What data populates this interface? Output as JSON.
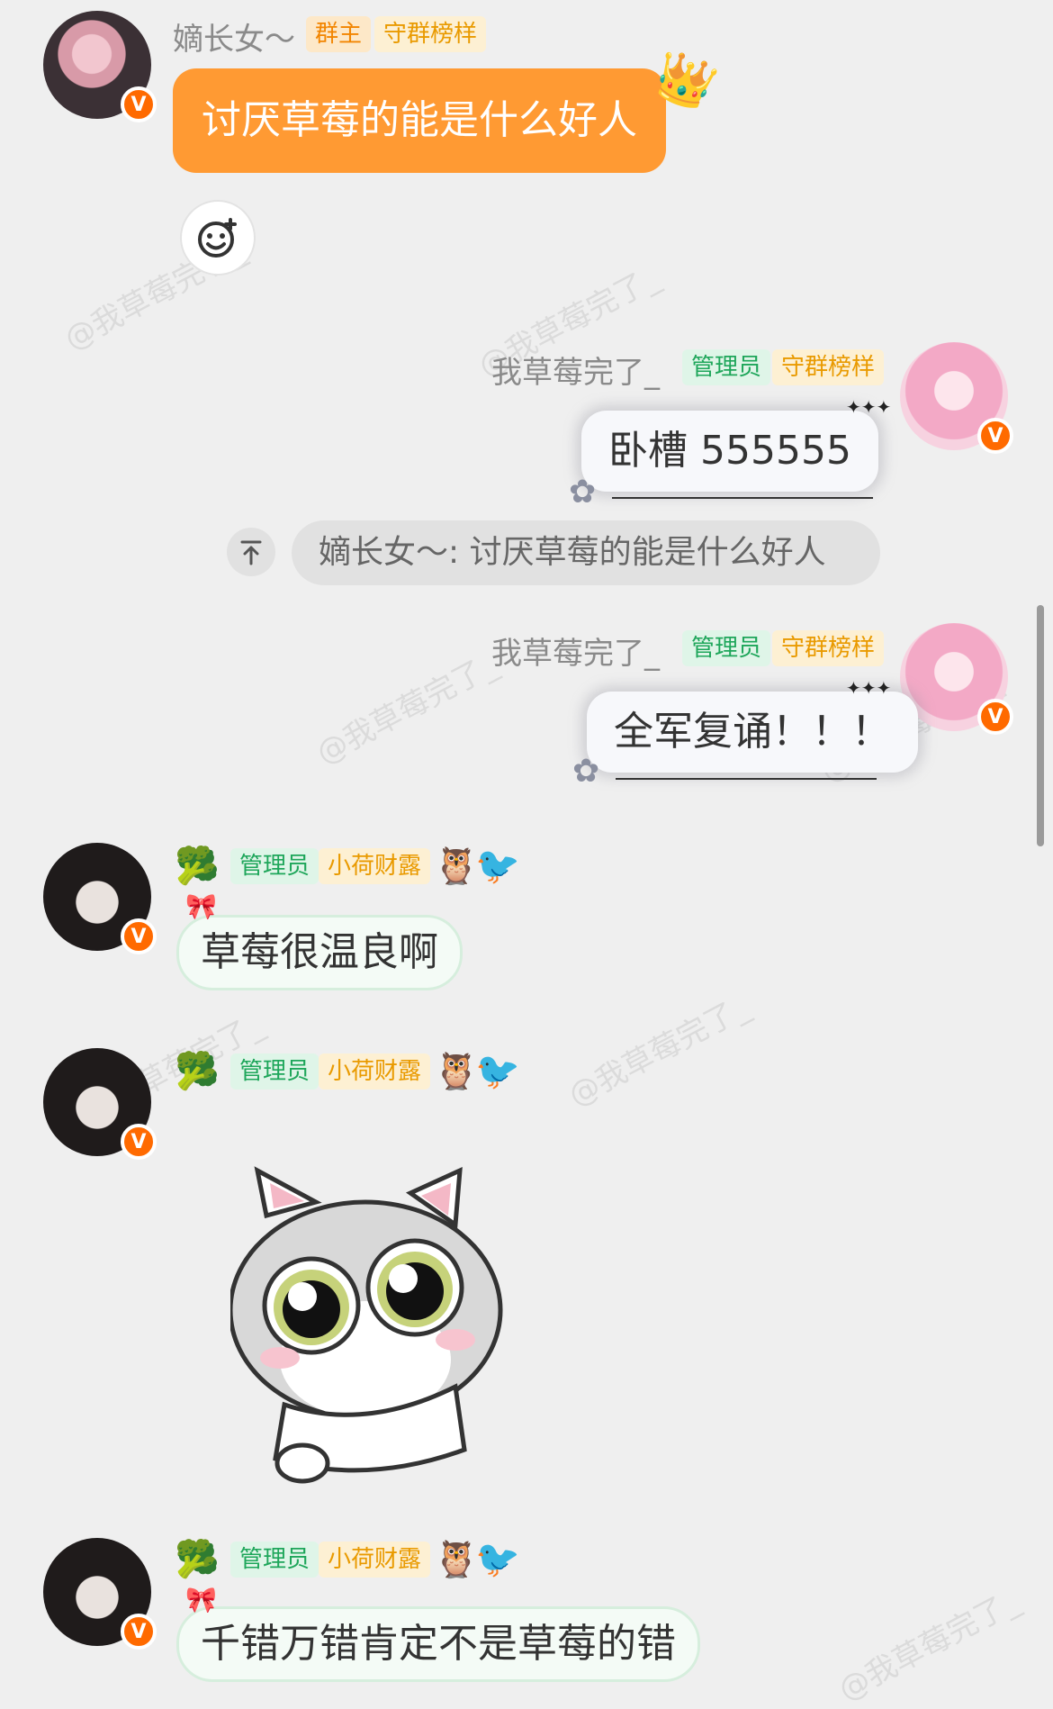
{
  "watermark": "@我草莓完了_",
  "messages": [
    {
      "sender": "嫡长女～",
      "tags": [
        "群主",
        "守群榜样"
      ],
      "text": "讨厌草莓的能是什么好人"
    },
    {
      "sender": "我草莓完了_",
      "tags": [
        "管理员",
        "守群榜样"
      ],
      "text": "卧槽 555555",
      "quote": "嫡长女～: 讨厌草莓的能是什么好人"
    },
    {
      "sender": "我草莓完了_",
      "tags": [
        "管理员",
        "守群榜样"
      ],
      "text": "全军复诵！！！"
    },
    {
      "tags": [
        "管理员",
        "小荷财露"
      ],
      "text": "草莓很温良啊"
    },
    {
      "tags": [
        "管理员",
        "小荷财露"
      ],
      "sticker": "crying-cat-sticker"
    },
    {
      "tags": [
        "管理员",
        "小荷财露"
      ],
      "text": "千错万错肯定不是草莓的错"
    }
  ],
  "icons": {
    "verified": "V",
    "add_reaction": "smiley-plus-icon",
    "quote_arrow": "arrow-up-icon"
  },
  "colors": {
    "background": "#efefef",
    "accent_orange": "#ff9a33",
    "admin_green": "#1ea65a",
    "owner_orange": "#f28500"
  }
}
